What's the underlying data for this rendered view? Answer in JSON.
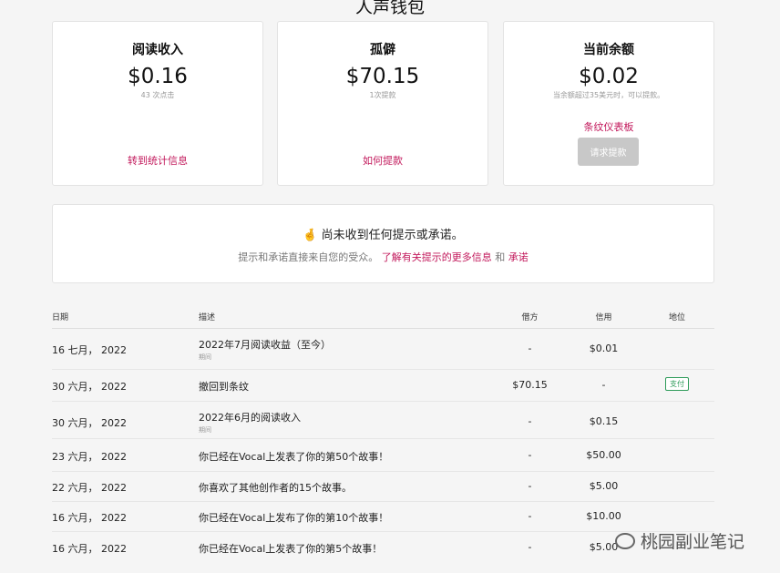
{
  "page_title": "人声钱包",
  "cards": [
    {
      "title": "阅读收入",
      "amount": "$0.16",
      "sub": "43 次点击",
      "link": "转到统计信息"
    },
    {
      "title": "孤僻",
      "amount": "$70.15",
      "sub": "1次提款",
      "link": "如何提款"
    },
    {
      "title": "当前余额",
      "amount": "$0.02",
      "sub": "当余额超过35美元时，可以提款。",
      "link": "条纹仪表板",
      "button": "请求提款"
    }
  ],
  "notice": {
    "emoji": "🤞",
    "title": "尚未收到任何提示或承诺。",
    "text": "提示和承诺直接来自您的受众。",
    "link1": "了解有关提示的更多信息",
    "and": "和",
    "link2": "承诺"
  },
  "table": {
    "headers": {
      "date": "日期",
      "desc": "描述",
      "debit": "借方",
      "credit": "信用",
      "status": "地位"
    },
    "rows": [
      {
        "date": "16 七月， 2022",
        "desc": "2022年7月阅读收益（至今）",
        "sub": "期间",
        "debit": "-",
        "credit": "$0.01",
        "status": ""
      },
      {
        "date": "30 六月， 2022",
        "desc": "撤回到条纹",
        "sub": "",
        "debit": "$70.15",
        "credit": "-",
        "status": "支付"
      },
      {
        "date": "30 六月， 2022",
        "desc": "2022年6月的阅读收入",
        "sub": "期间",
        "debit": "-",
        "credit": "$0.15",
        "status": ""
      },
      {
        "date": "23 六月， 2022",
        "desc": "你已经在Vocal上发表了你的第50个故事！",
        "sub": "",
        "debit": "-",
        "credit": "$50.00",
        "status": ""
      },
      {
        "date": "22 六月， 2022",
        "desc": "你喜欢了其他创作者的15个故事。",
        "sub": "",
        "debit": "-",
        "credit": "$5.00",
        "status": ""
      },
      {
        "date": "16 六月， 2022",
        "desc": "你已经在Vocal上发布了你的第10个故事！",
        "sub": "",
        "debit": "-",
        "credit": "$10.00",
        "status": ""
      },
      {
        "date": "16 六月， 2022",
        "desc": "你已经在Vocal上发表了你的第5个故事！",
        "sub": "",
        "debit": "-",
        "credit": "$5.00",
        "status": ""
      }
    ]
  },
  "watermark": "桃园副业笔记"
}
